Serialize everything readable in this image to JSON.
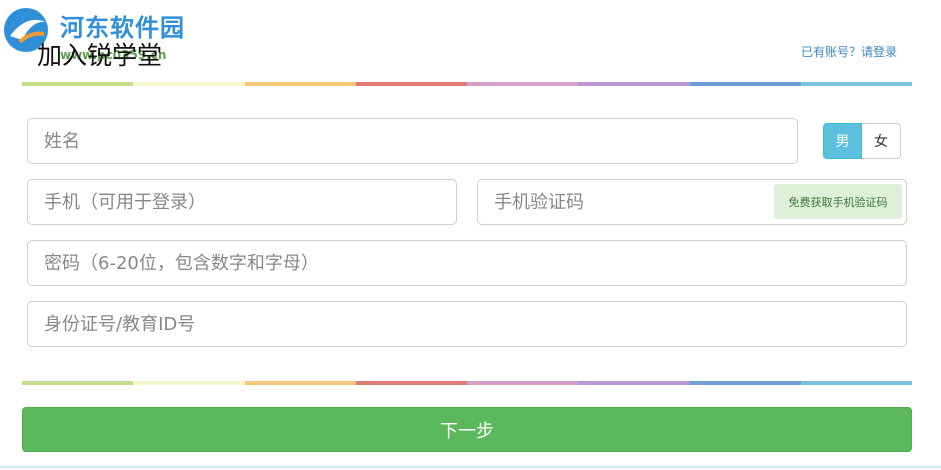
{
  "watermark": {
    "name": "河东软件园",
    "url": "www.pc0359.cn"
  },
  "page": {
    "title": "加入锐学堂",
    "login_link": "已有账号？请登录"
  },
  "rainbow_colors": [
    "#c3dd8a",
    "#f4f7cf",
    "#f2c878",
    "#e07a74",
    "#d4a0c8",
    "#b99ad4",
    "#6f9fd6",
    "#76c3dc"
  ],
  "form": {
    "name_placeholder": "姓名",
    "gender": {
      "male": "男",
      "female": "女",
      "selected": "男"
    },
    "phone_placeholder": "手机（可用于登录）",
    "sms_code_placeholder": "手机验证码",
    "sms_button": "免费获取手机验证码",
    "password_placeholder": "密码（6-20位，包含数字和字母）",
    "id_placeholder": "身份证号/教育ID号"
  },
  "actions": {
    "next": "下一步"
  }
}
